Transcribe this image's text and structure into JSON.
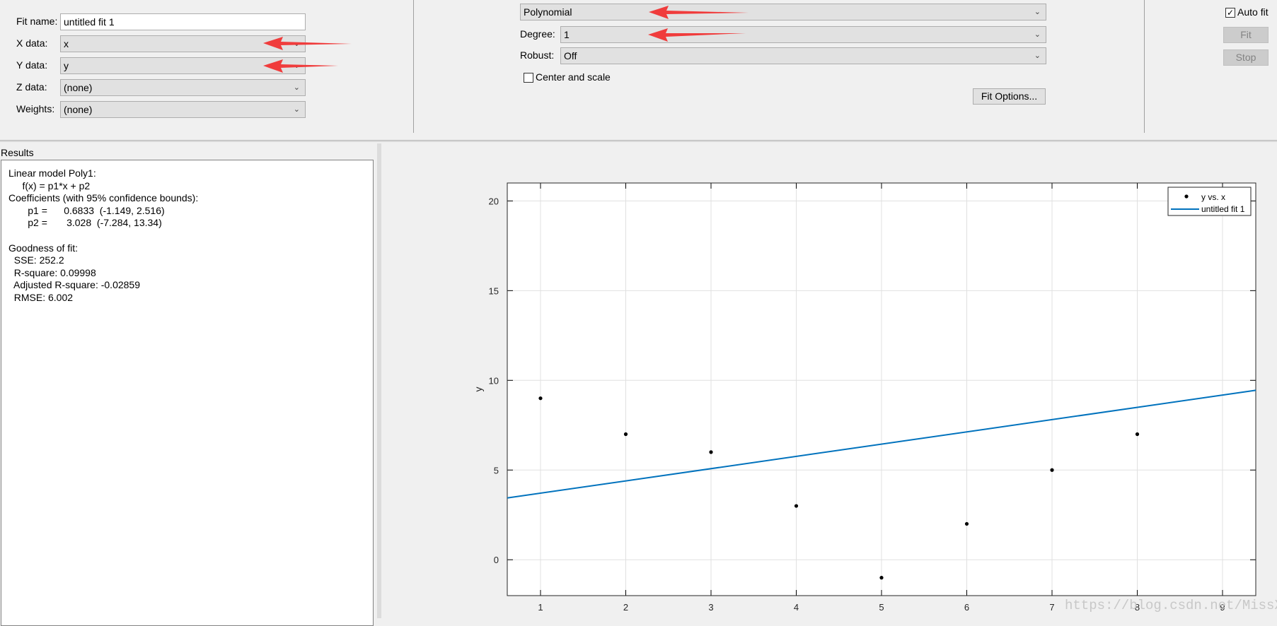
{
  "top_left": {
    "fit_name_label": "Fit name:",
    "fit_name_value": "untitled fit 1",
    "x_data_label": "X data:",
    "x_data_value": "x",
    "y_data_label": "Y data:",
    "y_data_value": "y",
    "z_data_label": "Z data:",
    "z_data_value": "(none)",
    "weights_label": "Weights:",
    "weights_value": "(none)"
  },
  "top_mid": {
    "fit_type": "Polynomial",
    "degree_label": "Degree:",
    "degree_value": "1",
    "robust_label": "Robust:",
    "robust_value": "Off",
    "center_scale_label": "Center and scale",
    "center_scale_checked": false,
    "fit_options_label": "Fit Options..."
  },
  "top_right": {
    "auto_fit_label": "Auto fit",
    "auto_fit_checked": true,
    "fit_label": "Fit",
    "stop_label": "Stop"
  },
  "results": {
    "title": "Results",
    "lines": [
      "Linear model Poly1:",
      "     f(x) = p1*x + p2",
      "Coefficients (with 95% confidence bounds):",
      "       p1 =      0.6833  (-1.149, 2.516)",
      "       p2 =       3.028  (-7.284, 13.34)",
      "",
      "Goodness of fit:",
      "  SSE: 252.2",
      "  R-square: 0.09998",
      "  Adjusted R-square: -0.02859",
      "  RMSE: 6.002"
    ]
  },
  "watermark": "https://blog.csdn.net/MissXy_",
  "annotation_color": "#f03c3c",
  "chart_data": {
    "type": "scatter",
    "xlabel": "",
    "ylabel": "y",
    "xlim": [
      0.61,
      9.39
    ],
    "ylim": [
      -2,
      21
    ],
    "xticks": [
      1,
      2,
      3,
      4,
      5,
      6,
      7,
      8,
      9
    ],
    "yticks": [
      0,
      5,
      10,
      15,
      20
    ],
    "grid": true,
    "legend_placement": "top-right",
    "series": [
      {
        "name": "y vs. x",
        "type": "scatter",
        "color": "#000000",
        "x": [
          1,
          2,
          3,
          4,
          5,
          6,
          7,
          8
        ],
        "y": [
          9,
          7,
          6,
          3,
          -1,
          2,
          5,
          7
        ]
      },
      {
        "name": "untitled fit 1",
        "type": "line",
        "color": "#0072bd",
        "slope": 0.6833,
        "intercept": 3.028
      }
    ]
  }
}
